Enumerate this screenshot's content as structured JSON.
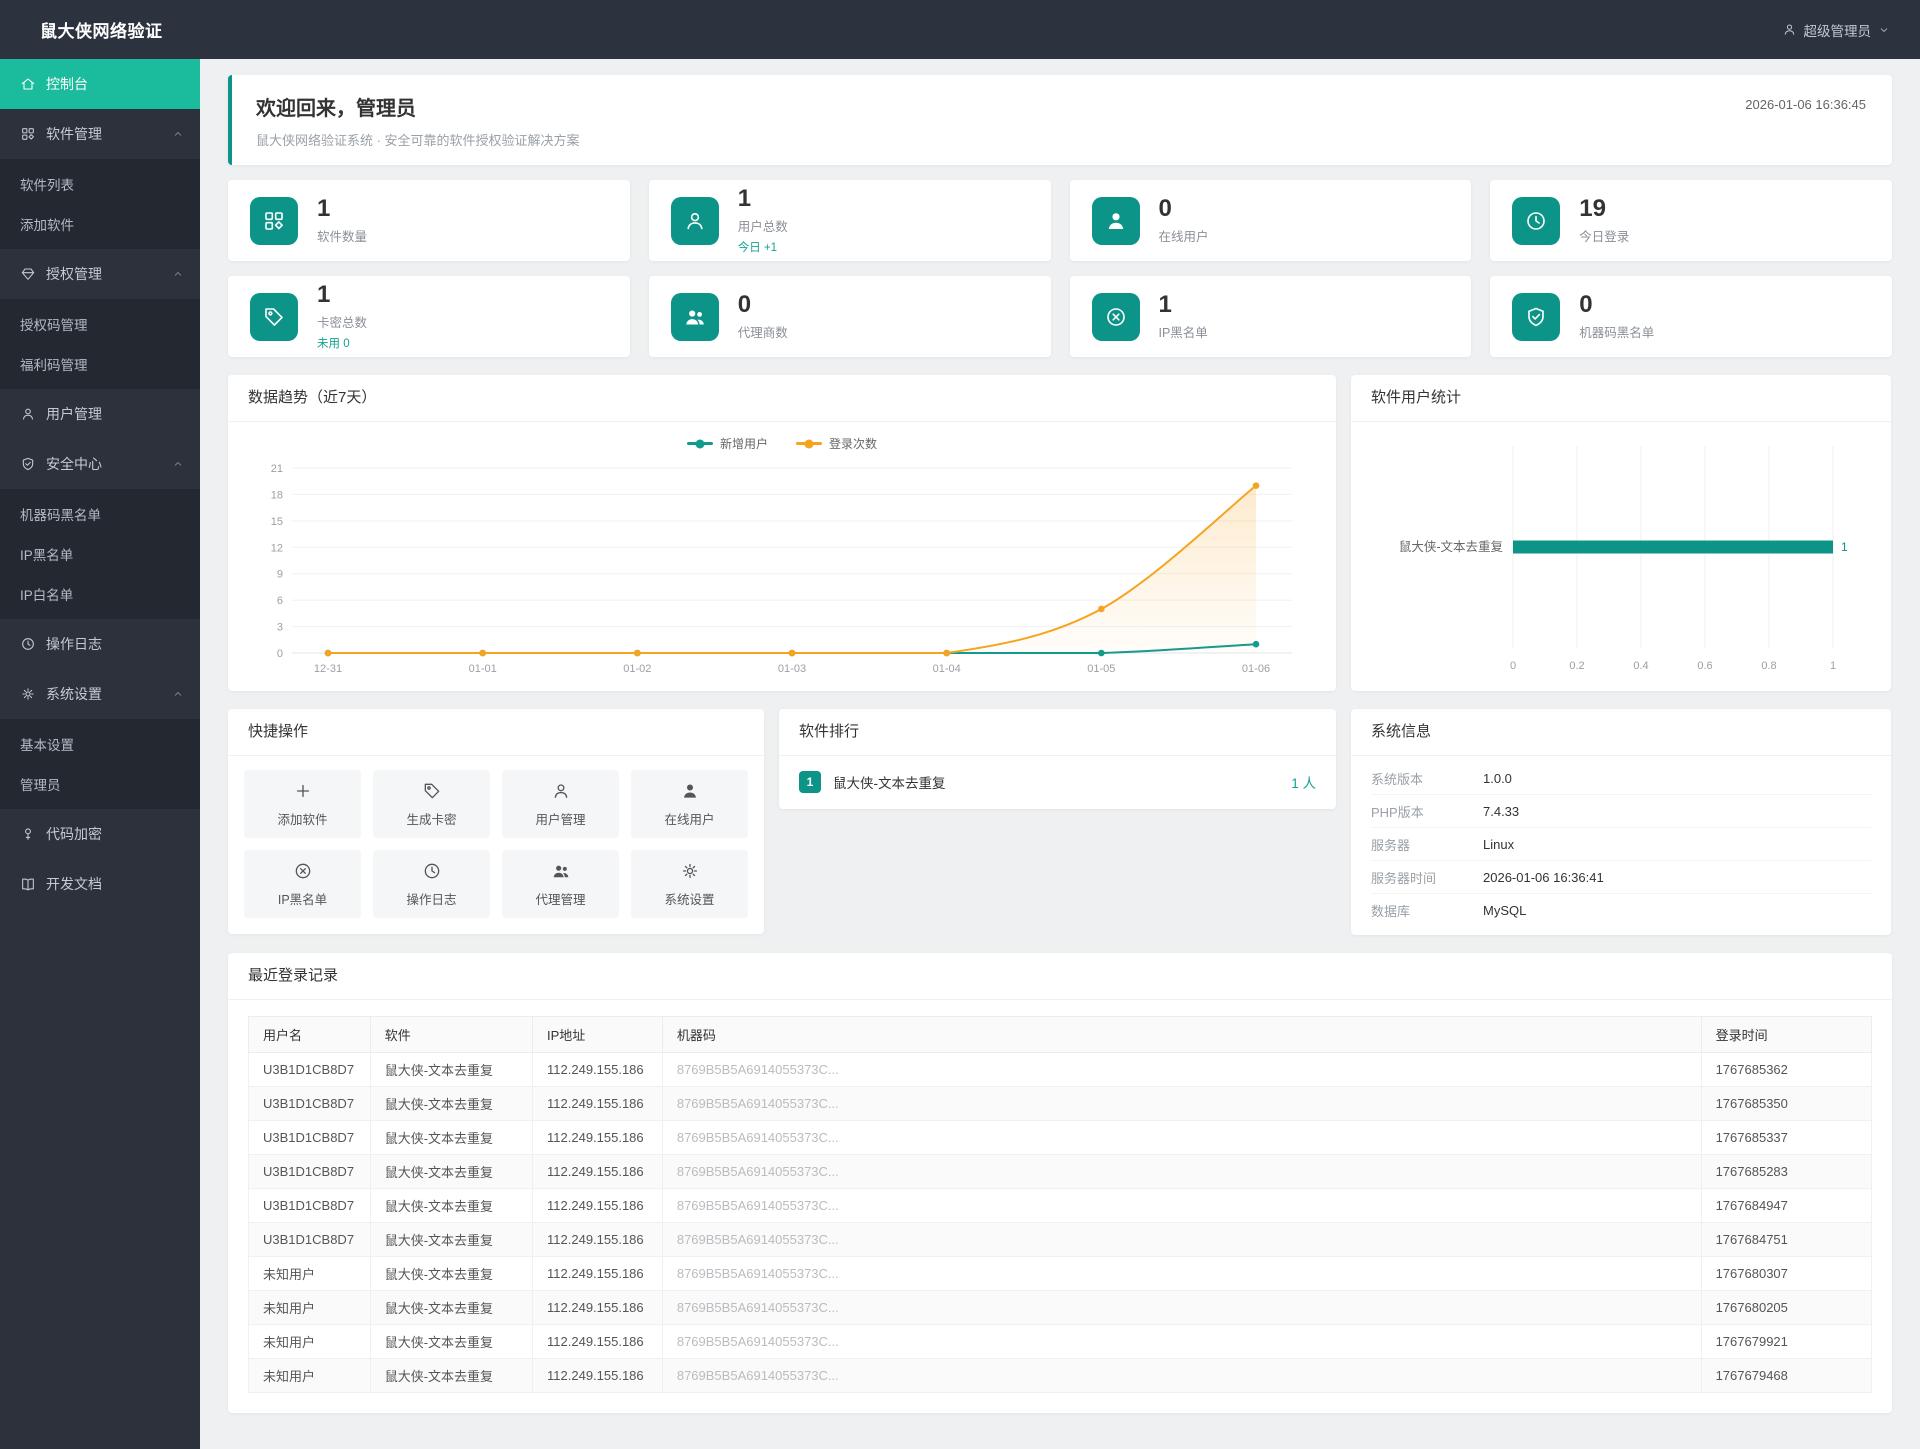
{
  "app": {
    "title": "鼠大侠网络验证"
  },
  "header": {
    "user": "超级管理员"
  },
  "colors": {
    "accent": "#0d9488",
    "sidebar_active": "#1bbc9d",
    "teal_text": "#11a390",
    "line_teal": "#0f9b8e",
    "line_orange": "#f6a31f"
  },
  "sidebar": {
    "items": [
      {
        "label": "控制台",
        "icon": "home",
        "active": true
      },
      {
        "label": "软件管理",
        "icon": "apps",
        "children": [
          "软件列表",
          "添加软件"
        ]
      },
      {
        "label": "授权管理",
        "icon": "gem",
        "children": [
          "授权码管理",
          "福利码管理"
        ]
      },
      {
        "label": "用户管理",
        "icon": "user"
      },
      {
        "label": "安全中心",
        "icon": "shield-check",
        "children": [
          "机器码黑名单",
          "IP黑名单",
          "IP白名单"
        ]
      },
      {
        "label": "操作日志",
        "icon": "clock"
      },
      {
        "label": "系统设置",
        "icon": "gear",
        "children": [
          "基本设置",
          "管理员"
        ]
      },
      {
        "label": "代码加密",
        "icon": "key"
      },
      {
        "label": "开发文档",
        "icon": "book"
      }
    ]
  },
  "welcome": {
    "title": "欢迎回来，管理员",
    "subtitle": "鼠大侠网络验证系统 · 安全可靠的软件授权验证解决方案",
    "timestamp": "2026-01-06 16:36:45"
  },
  "stats": [
    {
      "value": "1",
      "label": "软件数量",
      "icon": "apps",
      "sub": null
    },
    {
      "value": "1",
      "label": "用户总数",
      "icon": "user",
      "sub": "今日 +1"
    },
    {
      "value": "0",
      "label": "在线用户",
      "icon": "user-solid",
      "sub": null
    },
    {
      "value": "19",
      "label": "今日登录",
      "icon": "clock",
      "sub": null
    },
    {
      "value": "1",
      "label": "卡密总数",
      "icon": "tag",
      "sub": "未用 0"
    },
    {
      "value": "0",
      "label": "代理商数",
      "icon": "users",
      "sub": null
    },
    {
      "value": "1",
      "label": "IP黑名单",
      "icon": "ban",
      "sub": null
    },
    {
      "value": "0",
      "label": "机器码黑名单",
      "icon": "shield-check",
      "sub": null
    }
  ],
  "chart_data": [
    {
      "type": "line",
      "title": "数据趋势（近7天）",
      "x": [
        "12-31",
        "01-01",
        "01-02",
        "01-03",
        "01-04",
        "01-05",
        "01-06"
      ],
      "series": [
        {
          "name": "新增用户",
          "color": "#0f9b8e",
          "values": [
            0,
            0,
            0,
            0,
            0,
            0,
            1
          ],
          "area": false
        },
        {
          "name": "登录次数",
          "color": "#f6a31f",
          "values": [
            0,
            0,
            0,
            0,
            0,
            5,
            19
          ],
          "area": true
        }
      ],
      "ylim": [
        0,
        21
      ],
      "yticks": [
        0,
        3,
        6,
        9,
        12,
        15,
        18,
        21
      ],
      "grid": true,
      "legend_position": "top"
    },
    {
      "type": "bar",
      "title": "软件用户统计",
      "orientation": "horizontal",
      "categories": [
        "鼠大侠-文本去重复"
      ],
      "values": [
        1
      ],
      "xlim": [
        0,
        1
      ],
      "xticks": [
        0,
        0.2,
        0.4,
        0.6,
        0.8,
        1
      ],
      "color": "#0d9488",
      "grid": true
    }
  ],
  "quick_actions": {
    "title": "快捷操作",
    "items": [
      {
        "label": "添加软件",
        "icon": "plus"
      },
      {
        "label": "生成卡密",
        "icon": "tag"
      },
      {
        "label": "用户管理",
        "icon": "user"
      },
      {
        "label": "在线用户",
        "icon": "user-solid"
      },
      {
        "label": "IP黑名单",
        "icon": "ban"
      },
      {
        "label": "操作日志",
        "icon": "clock"
      },
      {
        "label": "代理管理",
        "icon": "users"
      },
      {
        "label": "系统设置",
        "icon": "gear"
      }
    ]
  },
  "ranking": {
    "title": "软件排行",
    "items": [
      {
        "rank": "1",
        "name": "鼠大侠-文本去重复",
        "count": "1 人"
      }
    ]
  },
  "system_info": {
    "title": "系统信息",
    "rows": [
      {
        "label": "系统版本",
        "value": "1.0.0"
      },
      {
        "label": "PHP版本",
        "value": "7.4.33"
      },
      {
        "label": "服务器",
        "value": "Linux"
      },
      {
        "label": "服务器时间",
        "value": "2026-01-06 16:36:41"
      },
      {
        "label": "数据库",
        "value": "MySQL"
      }
    ]
  },
  "login_table": {
    "title": "最近登录记录",
    "headers": [
      "用户名",
      "软件",
      "IP地址",
      "机器码",
      "登录时间"
    ],
    "rows": [
      [
        "U3B1D1CB8D7",
        "鼠大侠-文本去重复",
        "112.249.155.186",
        "8769B5B5A6914055373C...",
        "1767685362"
      ],
      [
        "U3B1D1CB8D7",
        "鼠大侠-文本去重复",
        "112.249.155.186",
        "8769B5B5A6914055373C...",
        "1767685350"
      ],
      [
        "U3B1D1CB8D7",
        "鼠大侠-文本去重复",
        "112.249.155.186",
        "8769B5B5A6914055373C...",
        "1767685337"
      ],
      [
        "U3B1D1CB8D7",
        "鼠大侠-文本去重复",
        "112.249.155.186",
        "8769B5B5A6914055373C...",
        "1767685283"
      ],
      [
        "U3B1D1CB8D7",
        "鼠大侠-文本去重复",
        "112.249.155.186",
        "8769B5B5A6914055373C...",
        "1767684947"
      ],
      [
        "U3B1D1CB8D7",
        "鼠大侠-文本去重复",
        "112.249.155.186",
        "8769B5B5A6914055373C...",
        "1767684751"
      ],
      [
        "未知用户",
        "鼠大侠-文本去重复",
        "112.249.155.186",
        "8769B5B5A6914055373C...",
        "1767680307"
      ],
      [
        "未知用户",
        "鼠大侠-文本去重复",
        "112.249.155.186",
        "8769B5B5A6914055373C...",
        "1767680205"
      ],
      [
        "未知用户",
        "鼠大侠-文本去重复",
        "112.249.155.186",
        "8769B5B5A6914055373C...",
        "1767679921"
      ],
      [
        "未知用户",
        "鼠大侠-文本去重复",
        "112.249.155.186",
        "8769B5B5A6914055373C...",
        "1767679468"
      ]
    ]
  }
}
